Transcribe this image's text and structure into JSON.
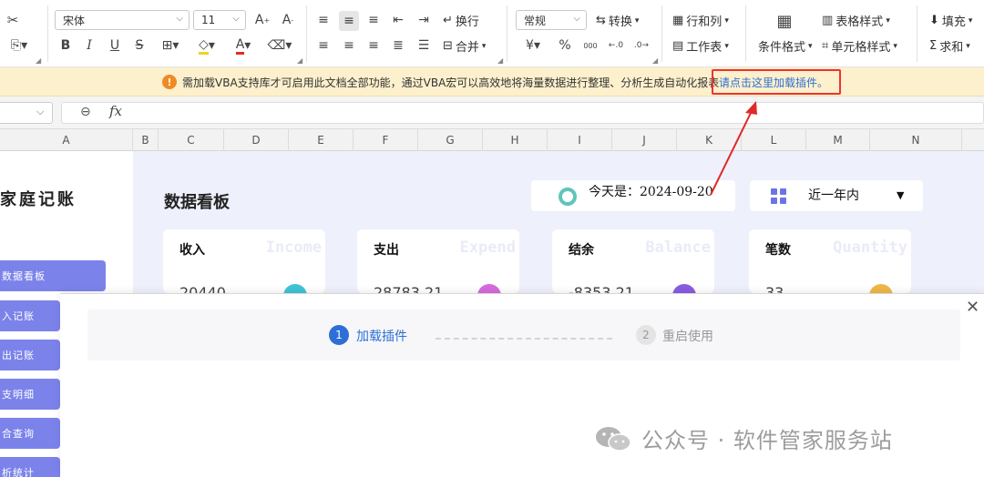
{
  "ribbon": {
    "font_name": "宋体",
    "font_size": "11",
    "wrap_label": "换行",
    "merge_label": "合并",
    "number_format": "常规",
    "convert_label": "转换",
    "rowcol_label": "行和列",
    "worksheet_label": "工作表",
    "cond_format_label": "条件格式",
    "table_style_label": "表格样式",
    "cell_style_label": "单元格样式",
    "fill_label": "填充",
    "sum_label": "求和",
    "currency_symbol": "¥",
    "percent_symbol": "%",
    "thousands_symbol": "000"
  },
  "notice": {
    "text": "需加载VBA支持库才可启用此文档全部功能，通过VBA宏可以高效地将海量数据进行整理、分析生成自动化报表",
    "link": "请点击这里加载插件。",
    "highlight_color": "#e33333"
  },
  "formula_bar": {
    "fx": "fx"
  },
  "columns": [
    "A",
    "B",
    "C",
    "D",
    "E",
    "F",
    "G",
    "H",
    "I",
    "J",
    "K",
    "L",
    "M",
    "N"
  ],
  "sidebar": {
    "title": "家庭记账",
    "items": [
      "数据看板",
      "收入记账",
      "支出记账",
      "收支明细",
      "综合查询",
      "分析统计"
    ],
    "item_texts": [
      "数据看板",
      "入记账",
      "出记账",
      "支明细",
      "合查询",
      "析统计"
    ]
  },
  "dashboard": {
    "title": "数据看板",
    "today": "今天是：2024-09-20",
    "range": "近一年内",
    "cards": [
      {
        "title": "收入",
        "english": "Income",
        "value": "20440",
        "color": "#3fc4d8"
      },
      {
        "title": "支出",
        "english": "Expend",
        "value": "28783.21",
        "color": "#d66be0"
      },
      {
        "title": "结余",
        "english": "Balance",
        "value": "-8353.21",
        "color": "#8a5de0"
      },
      {
        "title": "笔数",
        "english": "Quantity",
        "value": "33",
        "color": "#f0b648"
      }
    ]
  },
  "dialog": {
    "step1_num": "1",
    "step1": "加载插件",
    "step2_num": "2",
    "step2": "重启使用",
    "accent_color": "#2d6fd6"
  },
  "watermark": "公众号 · 软件管家服务站"
}
